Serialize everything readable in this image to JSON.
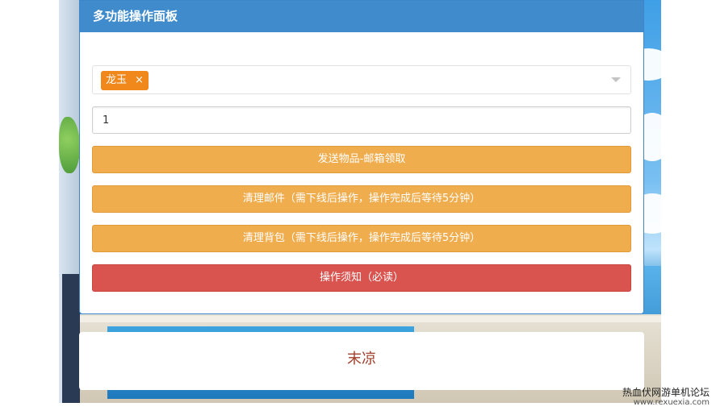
{
  "panel": {
    "title": "多功能操作面板",
    "select": {
      "tags": [
        {
          "label": "龙玉",
          "remove": "×"
        }
      ]
    },
    "quantity": {
      "value": "1"
    },
    "buttons": {
      "send_item": "发送物品-邮箱领取",
      "clear_mail": "清理邮件（需下线后操作，操作完成后等待5分钟）",
      "clear_bag": "清理背包（需下线后操作，操作完成后等待5分钟）",
      "notice": "操作须知（必读）"
    }
  },
  "footer": {
    "text": "末凉"
  },
  "watermark": {
    "title": "热血伏网游单机论坛",
    "url": "www.rexuexia.com"
  },
  "colors": {
    "header_bg": "#3f8bcc",
    "tag_bg": "#f0881c",
    "warning_btn": "#f0ad4e",
    "danger_btn": "#d9534f",
    "footer_text": "#a0402a"
  }
}
